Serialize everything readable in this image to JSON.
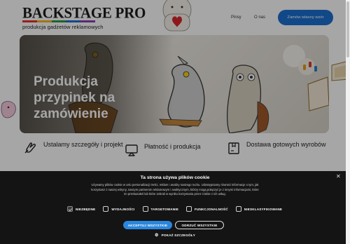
{
  "header": {
    "logo_title": "BACKSTAGE PRO",
    "logo_subtitle": "produkcja gadżetów reklamowych",
    "logo_stripes": [
      "#e8322b",
      "#f4b622",
      "#2a9b46",
      "#1f6fd2",
      "#8d3fb3"
    ],
    "nav": [
      {
        "label": "Pinsy"
      },
      {
        "label": "O nas"
      }
    ],
    "cta_label": "Zamów własny wzór",
    "cta_color": "#1b6fd1"
  },
  "hero": {
    "title": "Produkcja przypinek na zamówienie"
  },
  "features": [
    {
      "icon": "hand-icon",
      "text": "Ustalamy szczegóły i projekt"
    },
    {
      "icon": "payment-screen-icon",
      "text": "Płatność i produkcja"
    },
    {
      "icon": "box-icon",
      "text": "Dostawa gotowych wyrobów"
    }
  ],
  "cookie": {
    "title": "Ta strona używa plików cookie",
    "body": "Używamy plików cookie w celu personalizacji treści, reklam i analizy naszego ruchu. Udostępniamy również informacje o tym, jak korzystasz z naszej witryny, naszym partnerom reklamowym i analitycznym, którzy mogą połączyć je z innymi informacjami, które im przekazałeś lub które zebrali w wyniku korzystania przez Ciebie z ich usług.",
    "options": [
      {
        "label": "NIEZBĘDNE",
        "checked": true
      },
      {
        "label": "WYDAJNOŚCI",
        "checked": false
      },
      {
        "label": "TARGETOWANIE",
        "checked": false
      },
      {
        "label": "FUNKCJONALNOŚĆ",
        "checked": false
      },
      {
        "label": "NIESKLASYFIKOWANE",
        "checked": false
      }
    ],
    "accept_label": "AKCEPTUJ WSZYSTKIE",
    "reject_label": "ODRZUĆ WSZYSTKIE",
    "details_label": "POKAŻ SZCZEGÓŁY",
    "accent_color": "#2a86dd"
  }
}
